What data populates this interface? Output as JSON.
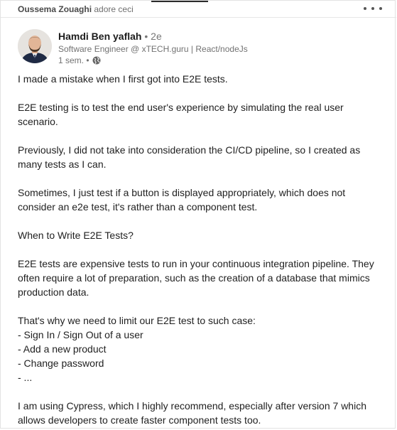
{
  "activity": {
    "actor": "Oussema Zouaghi",
    "action": "adore ceci"
  },
  "author": {
    "name": "Hamdi Ben yaflah",
    "degree": "• 2e",
    "headline": "Software Engineer @ xTECH.guru | React/nodeJs",
    "time": "1 sem. •"
  },
  "post": {
    "paragraphs": [
      "I made a mistake when I first got into E2E tests.",
      "E2E testing is to test the end user's experience by simulating the real user scenario.",
      "Previously, I did not take into consideration the CI/CD pipeline, so I created as many tests as I can.",
      "Sometimes, I just test if a button is displayed appropriately, which does not consider an e2e test, it's rather than a component test.",
      "When to Write E2E Tests?",
      "E2E tests are expensive tests to run in your continuous integration pipeline. They often require a lot of preparation, such as the creation of a database that mimics production data."
    ],
    "list_intro": "That's why we need to limit our E2E test to such case:",
    "list_items": [
      "- Sign In / Sign Out of a user",
      "- Add a new product",
      "- Change password",
      "- ..."
    ],
    "closing": "I am using Cypress, which I highly recommend, especially after version 7 which allows developers to create faster component tests too."
  },
  "icons": {
    "menu": "more-horizontal-icon",
    "visibility": "globe-icon"
  },
  "colors": {
    "text": "#1f1f1f",
    "muted": "#727272"
  }
}
